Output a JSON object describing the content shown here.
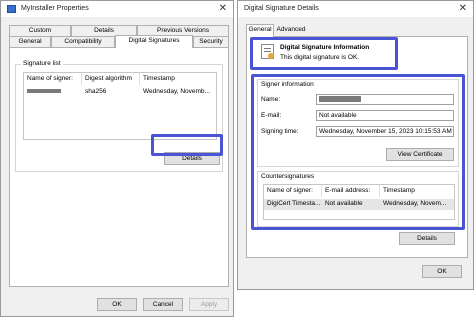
{
  "left_window": {
    "title": "MyInstaller Properties",
    "tabs_row1": [
      "Custom",
      "Details",
      "Previous Versions"
    ],
    "tabs_row2": [
      "General",
      "Compatibility",
      "Digital Signatures",
      "Security"
    ],
    "signature_list_label": "Signature list",
    "columns": [
      "Name of signer:",
      "Digest algorithm",
      "Timestamp"
    ],
    "rows": [
      {
        "digest": "sha256",
        "timestamp": "Wednesday, Novemb..."
      }
    ],
    "details_button": "Details",
    "ok": "OK",
    "cancel": "Cancel",
    "apply": "Apply"
  },
  "right_window": {
    "title": "Digital Signature Details",
    "tabs": [
      "General",
      "Advanced"
    ],
    "info_title": "Digital Signature Information",
    "info_text": "This digital signature is OK.",
    "signer_info_label": "Signer information",
    "name_label": "Name:",
    "email_label": "E-mail:",
    "email_value": "Not available",
    "signing_time_label": "Signing time:",
    "signing_time_value": "Wednesday, November 15, 2023 10:15:53 AM",
    "view_certificate": "View Certificate",
    "countersignatures_label": "Countersignatures",
    "cs_columns": [
      "Name of signer:",
      "E-mail address:",
      "Timestamp"
    ],
    "cs_rows": [
      {
        "name": "DigiCert Timesta...",
        "email": "Not available",
        "timestamp": "Wednesday, Novem..."
      }
    ],
    "details_button": "Details",
    "ok": "OK"
  },
  "colors": {
    "highlight": "#4a55d6"
  }
}
